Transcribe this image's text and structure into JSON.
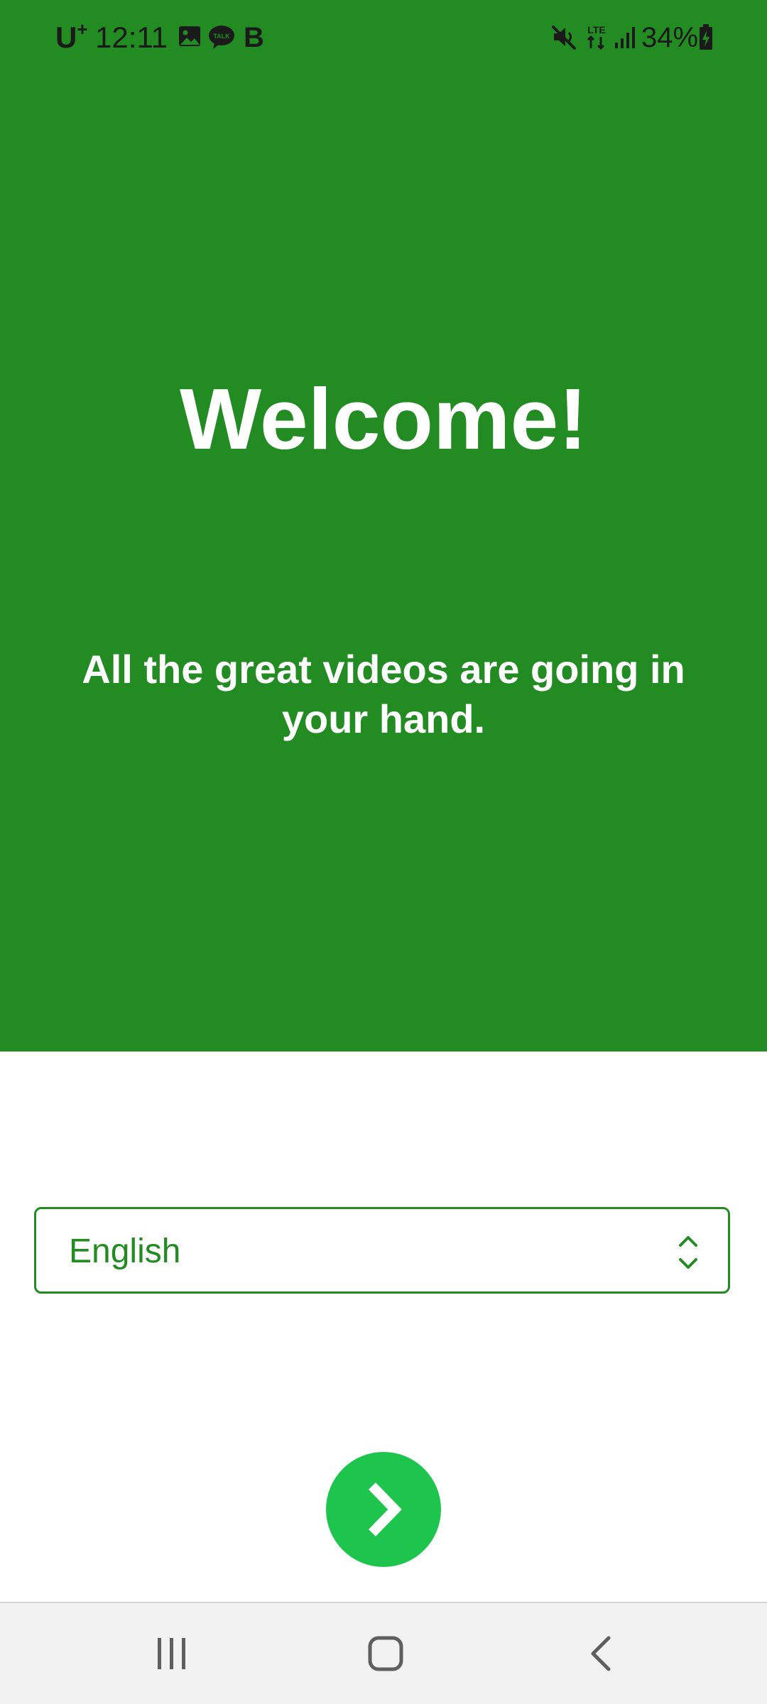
{
  "status_bar": {
    "carrier": "U",
    "carrier_sup": "+",
    "time": "12:11",
    "notification_b": "B",
    "battery_percent": "34%",
    "icons": [
      "image-icon",
      "talk-icon",
      "mute-icon",
      "lte-icon",
      "signal-icon",
      "battery-charging-icon"
    ]
  },
  "hero": {
    "title": "Welcome!",
    "subtitle": "All the great videos are going in your hand.",
    "background_color": "#228b22"
  },
  "language_select": {
    "selected": "English",
    "icon": "chevron-up-down-icon",
    "accent_color": "#228b22"
  },
  "next_button": {
    "icon": "chevron-right-icon",
    "color": "#1ec54d"
  },
  "nav_bar": {
    "icons": [
      "recent-apps-icon",
      "home-icon",
      "back-icon"
    ]
  }
}
